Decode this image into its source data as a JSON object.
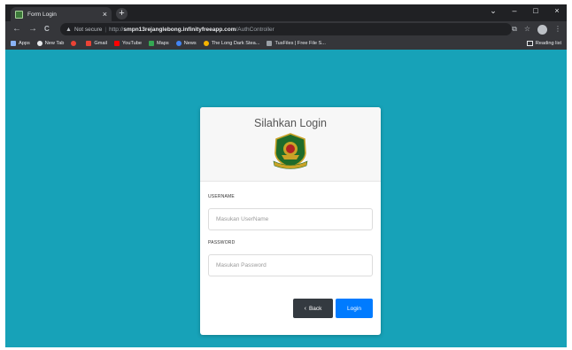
{
  "browser": {
    "tab_title": "Form Login",
    "tab_close": "×",
    "new_tab": "+",
    "controls": {
      "minimize": "–",
      "maximize": "□",
      "close": "×"
    },
    "nav": {
      "back": "←",
      "forward": "→",
      "reload": "C"
    },
    "security_label": "Not secure",
    "url_proto": "http://",
    "url_host": "smpn13rejanglebong.infinityfreeapp.com",
    "url_path": "/AuthController",
    "bookmarks": [
      {
        "label": "Apps",
        "color": "#8ab4f8"
      },
      {
        "label": "New Tab",
        "color": "#e8eaed"
      },
      {
        "label": "",
        "color": "#ea4335"
      },
      {
        "label": "Gmail",
        "color": "#ea4335"
      },
      {
        "label": "YouTube",
        "color": "#ff0000"
      },
      {
        "label": "Maps",
        "color": "#34a853"
      },
      {
        "label": "News",
        "color": "#4285f4"
      },
      {
        "label": "The Long Dark Stea...",
        "color": "#f4b400"
      },
      {
        "label": "TusFiles | Free File S...",
        "color": "#9aa0a6"
      }
    ],
    "reading_list": "Reading list"
  },
  "login": {
    "title": "Silahkan Login",
    "username_label": "USERNAME",
    "username_placeholder": "Masukan UserName",
    "password_label": "PASSWORD",
    "password_placeholder": "Masukan Password",
    "back_chevron": "‹",
    "back_label": "Back",
    "login_label": "Login"
  },
  "colors": {
    "page_background": "#17a2b8",
    "back_button": "#343a40",
    "login_button": "#007bff"
  }
}
